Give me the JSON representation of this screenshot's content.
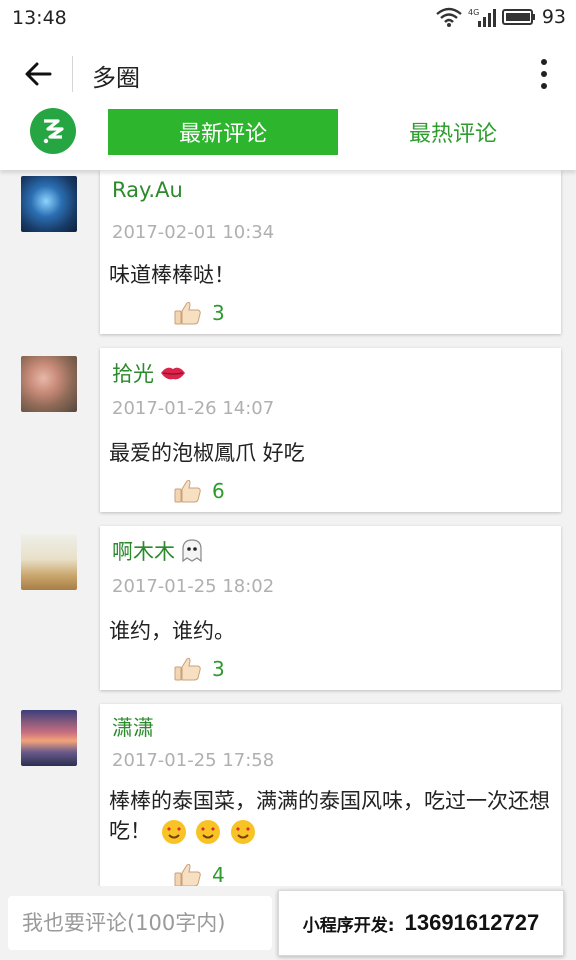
{
  "status_bar": {
    "time": "13:48",
    "network": "4G",
    "battery": "93"
  },
  "app_bar": {
    "title": "多圈"
  },
  "tabs": [
    {
      "label": "最新评论",
      "active": true
    },
    {
      "label": "最热评论",
      "active": false
    }
  ],
  "comments": [
    {
      "author": "Ray.Au",
      "emoji": "",
      "date": "2017-02-01 10:34",
      "text": "味道棒棒哒！",
      "likes": "3"
    },
    {
      "author": "拾光",
      "emoji": "lips-emoji",
      "date": "2017-01-26 14:07",
      "text": "最爱的泡椒鳳爪 好吃",
      "likes": "6"
    },
    {
      "author": "啊木木",
      "emoji": "ghost-emoji",
      "date": "2017-01-25 18:02",
      "text": "谁约，谁约。",
      "likes": "3"
    },
    {
      "author": "潇潇",
      "emoji": "",
      "date": "2017-01-25 17:58",
      "text": "棒棒的泰国菜，满满的泰国风味，吃过一次还想吃！",
      "likes": "4"
    }
  ],
  "bottom_bar": {
    "input_placeholder": "我也要评论(100字内)",
    "promo_label": "小程序开发:",
    "promo_phone": "13691612727"
  },
  "colors": {
    "accent_green": "#2eb52e",
    "author_green": "#2c8a2c",
    "date_gray": "#b0b0b0"
  }
}
